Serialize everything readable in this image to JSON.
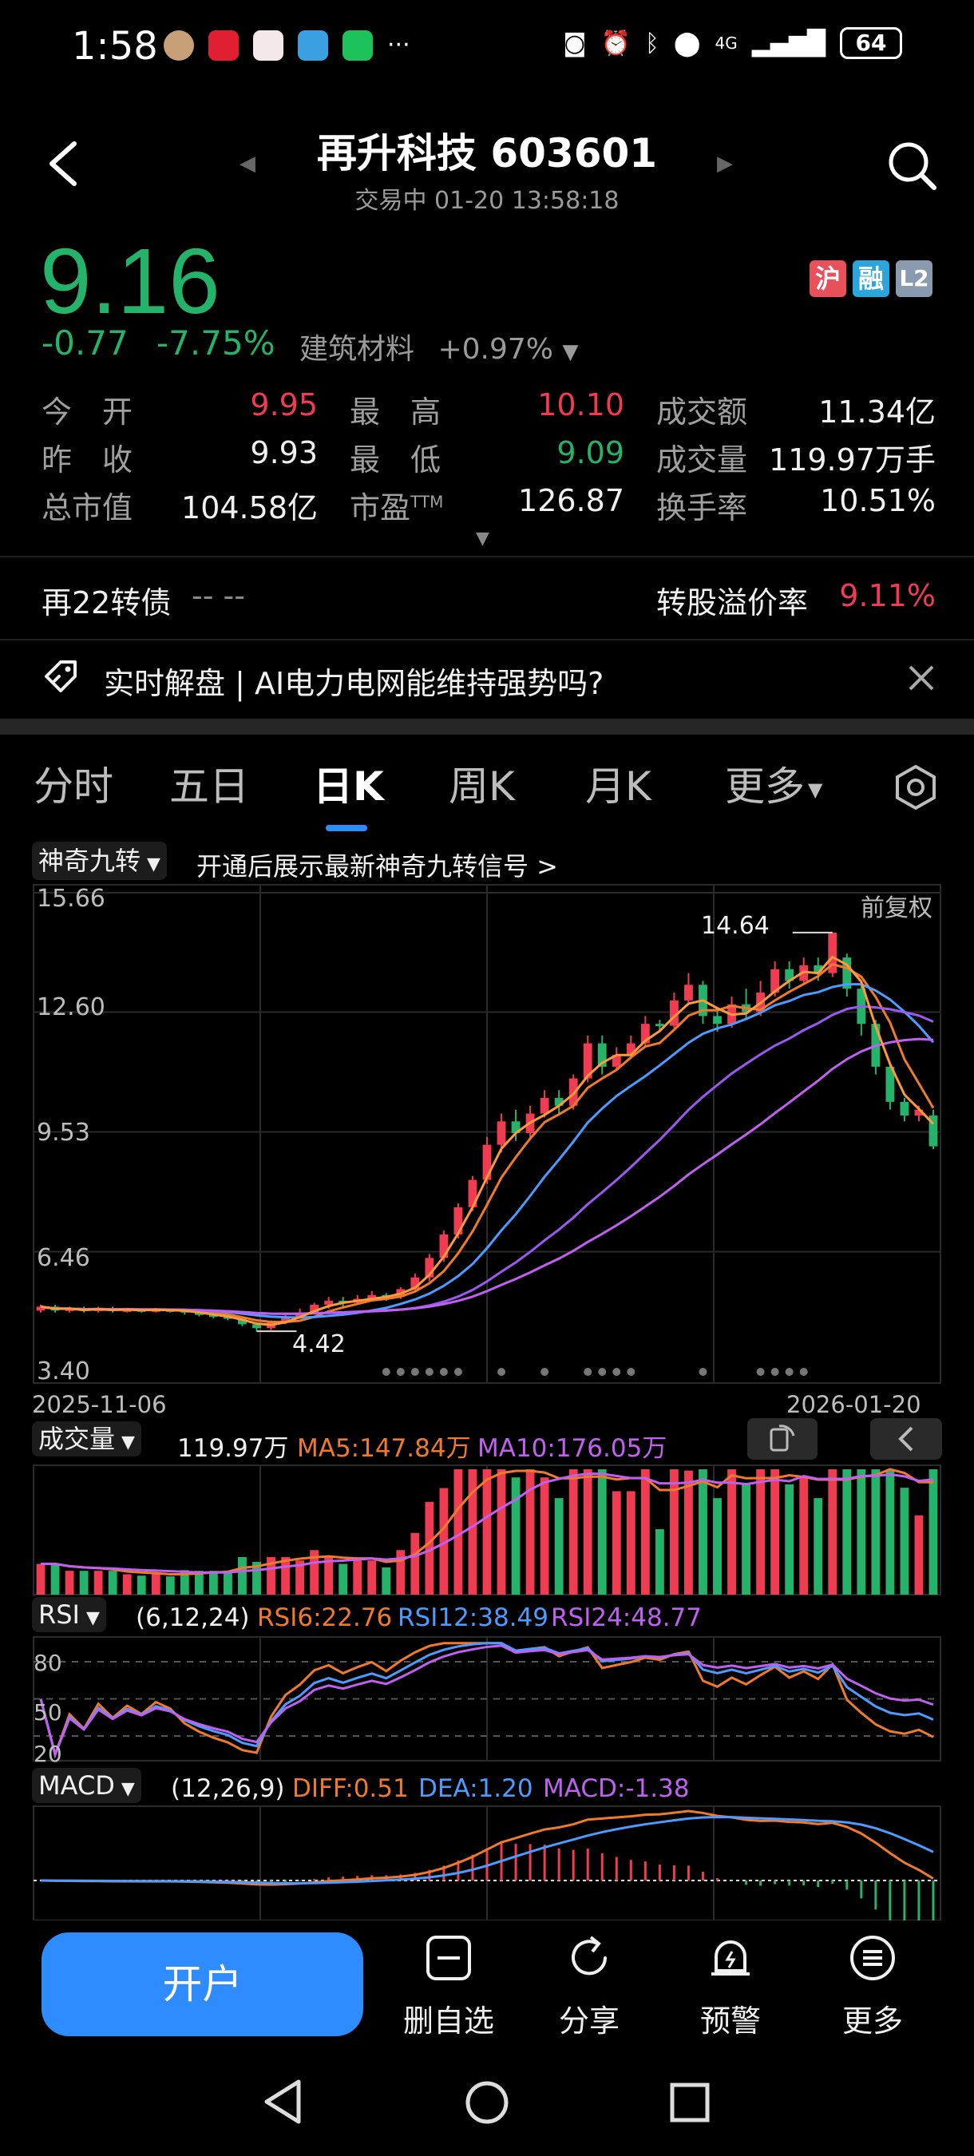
{
  "status_bar": {
    "time": "1:58",
    "more": "···",
    "network": "4G",
    "battery": "64"
  },
  "header": {
    "title": "再升科技 603601",
    "subtitle": "交易中 01-20 13:58:18"
  },
  "quote": {
    "price": "9.16",
    "change": "-0.77",
    "change_pct": "-7.75%",
    "sector": "建筑材料",
    "sector_change": "+0.97%",
    "badges": [
      "沪",
      "融",
      "L2"
    ]
  },
  "stats": [
    [
      {
        "label": "今　开",
        "value": "9.95",
        "color": "red"
      },
      {
        "label": "最　高",
        "value": "10.10",
        "color": "red"
      },
      {
        "label": "成交额",
        "value": "11.34亿",
        "color": "white"
      }
    ],
    [
      {
        "label": "昨　收",
        "value": "9.93",
        "color": "white"
      },
      {
        "label": "最　低",
        "value": "9.09",
        "color": "green"
      },
      {
        "label": "成交量",
        "value": "119.97万手",
        "color": "white"
      }
    ],
    [
      {
        "label": "总市值",
        "value": "104.58亿",
        "color": "white"
      },
      {
        "label": "市盈",
        "sup": "TTM",
        "value": "126.87",
        "color": "white"
      },
      {
        "label": "换手率",
        "value": "10.51%",
        "color": "white"
      }
    ]
  ],
  "bond": {
    "name": "再22转债",
    "value": "-- --",
    "premium_label": "转股溢价率",
    "premium_value": "9.11%"
  },
  "news": {
    "text": "实时解盘 | AI电力电网能维持强势吗?"
  },
  "tabs": [
    "分时",
    "五日",
    "日K",
    "周K",
    "月K",
    "更多"
  ],
  "active_tab": "日K",
  "kline": {
    "indicator": "神奇九转",
    "promo": "开通后展示最新神奇九转信号 >",
    "adjust": "前复权",
    "y_ticks": [
      "15.66",
      "12.60",
      "9.53",
      "6.46",
      "3.40"
    ],
    "high_label": "14.64",
    "low_label": "4.42",
    "date_start": "2025-11-06",
    "date_end": "2026-01-20"
  },
  "volume": {
    "indicator": "成交量",
    "value": "119.97万",
    "ma5": "MA5:147.84万",
    "ma10": "MA10:176.05万"
  },
  "rsi": {
    "indicator": "RSI",
    "params": "(6,12,24)",
    "rsi6": "RSI6:22.76",
    "rsi12": "RSI12:38.49",
    "rsi24": "RSI24:48.77",
    "levels": [
      "80",
      "50",
      "20"
    ]
  },
  "macd": {
    "indicator": "MACD",
    "params": "(12,26,9)",
    "diff": "DIFF:0.51",
    "dea": "DEA:1.20",
    "macd": "MACD:-1.38"
  },
  "bottom": {
    "open_account": "开户",
    "items": [
      "删自选",
      "分享",
      "预警",
      "更多"
    ]
  },
  "chart_data": {
    "type": "candlestick",
    "x_range": [
      "2025-11-06",
      "2026-01-20"
    ],
    "ylim": [
      3.4,
      15.66
    ],
    "candles": [
      [
        4.95,
        5.05,
        5.1,
        4.9
      ],
      [
        5.05,
        4.95,
        5.1,
        4.9
      ],
      [
        4.95,
        5.0,
        5.05,
        4.9
      ],
      [
        5.0,
        4.95,
        5.05,
        4.9
      ],
      [
        4.95,
        5.0,
        5.05,
        4.9
      ],
      [
        5.0,
        4.95,
        5.05,
        4.9
      ],
      [
        4.95,
        4.98,
        5.02,
        4.9
      ],
      [
        4.98,
        4.95,
        5.0,
        4.9
      ],
      [
        4.95,
        4.98,
        5.02,
        4.9
      ],
      [
        4.98,
        4.96,
        5.0,
        4.9
      ],
      [
        4.96,
        4.9,
        5.0,
        4.85
      ],
      [
        4.9,
        4.85,
        4.95,
        4.8
      ],
      [
        4.85,
        4.8,
        4.9,
        4.75
      ],
      [
        4.8,
        4.75,
        4.85,
        4.7
      ],
      [
        4.75,
        4.6,
        4.8,
        4.55
      ],
      [
        4.6,
        4.5,
        4.65,
        4.42
      ],
      [
        4.5,
        4.65,
        4.7,
        4.45
      ],
      [
        4.65,
        4.8,
        4.85,
        4.6
      ],
      [
        4.8,
        4.9,
        5.0,
        4.75
      ],
      [
        4.9,
        5.1,
        5.15,
        4.85
      ],
      [
        5.1,
        5.2,
        5.3,
        5.0
      ],
      [
        5.2,
        5.15,
        5.3,
        5.05
      ],
      [
        5.15,
        5.25,
        5.35,
        5.1
      ],
      [
        5.25,
        5.35,
        5.45,
        5.2
      ],
      [
        5.35,
        5.3,
        5.4,
        5.2
      ],
      [
        5.3,
        5.5,
        5.55,
        5.25
      ],
      [
        5.5,
        5.8,
        5.9,
        5.45
      ],
      [
        5.8,
        6.3,
        6.4,
        5.7
      ],
      [
        6.3,
        6.9,
        7.0,
        6.2
      ],
      [
        6.9,
        7.6,
        7.7,
        6.8
      ],
      [
        7.6,
        8.3,
        8.4,
        7.5
      ],
      [
        8.3,
        9.2,
        9.4,
        8.2
      ],
      [
        9.2,
        9.8,
        10.0,
        9.0
      ],
      [
        9.8,
        9.5,
        10.1,
        9.3
      ],
      [
        9.5,
        10.0,
        10.2,
        9.4
      ],
      [
        10.0,
        10.4,
        10.6,
        9.9
      ],
      [
        10.4,
        10.2,
        10.6,
        10.0
      ],
      [
        10.2,
        10.9,
        11.0,
        10.1
      ],
      [
        10.9,
        11.8,
        12.0,
        10.8
      ],
      [
        11.8,
        11.2,
        12.0,
        11.0
      ],
      [
        11.2,
        11.5,
        11.7,
        11.1
      ],
      [
        11.5,
        11.8,
        12.0,
        11.4
      ],
      [
        11.8,
        12.3,
        12.5,
        11.7
      ],
      [
        12.3,
        12.25,
        12.4,
        12.1
      ],
      [
        12.25,
        12.9,
        13.1,
        12.2
      ],
      [
        12.9,
        13.3,
        13.6,
        12.8
      ],
      [
        13.3,
        12.5,
        13.4,
        12.3
      ],
      [
        12.5,
        12.3,
        12.7,
        12.1
      ],
      [
        12.3,
        12.8,
        13.0,
        12.2
      ],
      [
        12.8,
        12.6,
        13.2,
        12.4
      ],
      [
        12.6,
        13.1,
        13.4,
        12.5
      ],
      [
        13.1,
        13.7,
        13.9,
        13.0
      ],
      [
        13.7,
        13.4,
        13.9,
        13.2
      ],
      [
        13.4,
        13.8,
        14.0,
        13.3
      ],
      [
        13.8,
        13.6,
        14.0,
        13.4
      ],
      [
        13.6,
        14.64,
        14.64,
        13.5
      ],
      [
        14.0,
        13.2,
        14.1,
        13.0
      ],
      [
        13.2,
        12.3,
        13.3,
        12.0
      ],
      [
        12.3,
        11.2,
        12.4,
        11.0
      ],
      [
        11.2,
        10.3,
        11.3,
        10.1
      ],
      [
        10.3,
        9.95,
        10.4,
        9.8
      ],
      [
        9.95,
        10.1,
        10.2,
        9.8
      ],
      [
        9.95,
        9.16,
        10.1,
        9.09
      ]
    ]
  }
}
